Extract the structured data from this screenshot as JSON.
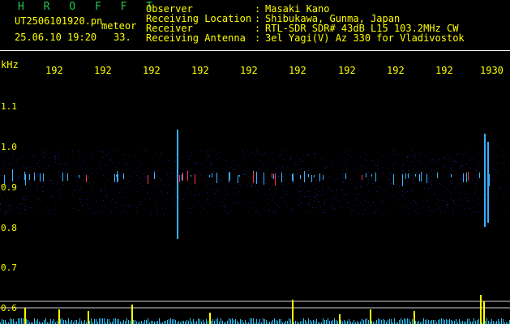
{
  "title": "H R O F F T",
  "file_name": "UT2506101920.pn",
  "meteor_label": "meteor",
  "datetime": "25.06.10 19:20",
  "count": "33.",
  "info": [
    {
      "label": "Observer",
      "value": "Masaki Kano"
    },
    {
      "label": "Receiving Location",
      "value": "Shibukawa, Gunma, Japan"
    },
    {
      "label": "Receiver",
      "value": "RTL-SDR SDR# 43dB L15 103.2MHz CW"
    },
    {
      "label": "Receiving Antenna",
      "value": "3el Yagi(V) Az 330 for Vladivostok"
    }
  ],
  "separator": ":",
  "y_unit": "kHz",
  "x_ticks": [
    "192",
    "192",
    "192",
    "192",
    "192",
    "192",
    "192",
    "192",
    "192",
    "1930"
  ],
  "y_ticks": [
    "1.1",
    "1.0",
    "0.9",
    "0.8",
    "0.7",
    "0.6"
  ],
  "colors": {
    "background": "#000000",
    "text": "#ffff00",
    "title": "#22c84a",
    "noise": "#1a1a8c",
    "signal_mid": "#3ab0ff",
    "signal_hot": "#ff3060",
    "level_bars": "#ffff00",
    "level_baseline": "#2ac8ff"
  }
}
